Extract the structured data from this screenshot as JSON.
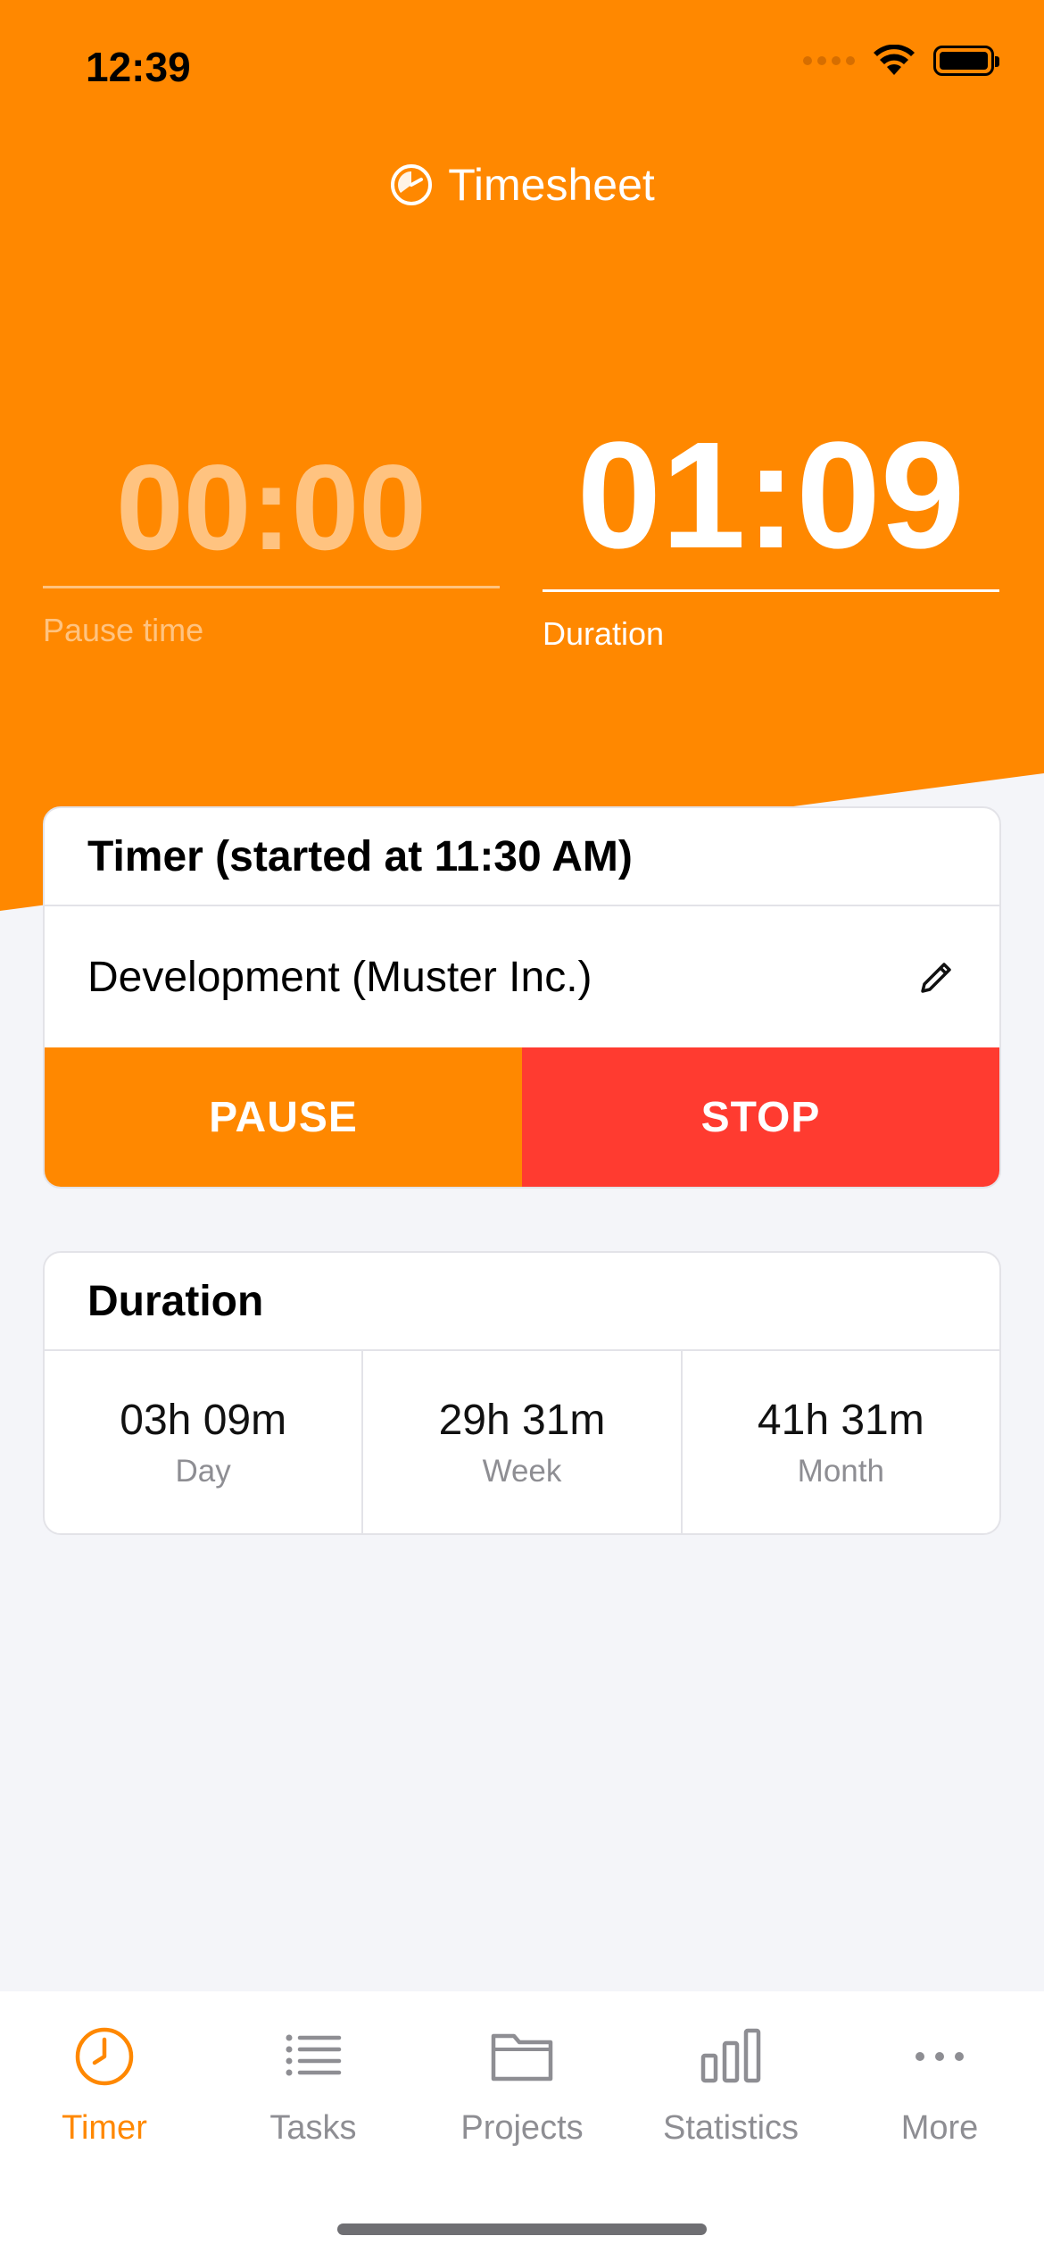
{
  "status_bar": {
    "time": "12:39"
  },
  "header": {
    "title": "Timesheet",
    "icon": "timer-logo-icon"
  },
  "timers": {
    "pause": {
      "value": "00:00",
      "label": "Pause time"
    },
    "duration": {
      "value": "01:09",
      "label": "Duration"
    }
  },
  "timer_card": {
    "title": "Timer (started at 11:30 AM)",
    "task": "Development (Muster Inc.)",
    "pause_label": "PAUSE",
    "stop_label": "STOP"
  },
  "duration_card": {
    "title": "Duration",
    "stats": [
      {
        "value": "03h 09m",
        "label": "Day"
      },
      {
        "value": "29h 31m",
        "label": "Week"
      },
      {
        "value": "41h 31m",
        "label": "Month"
      }
    ]
  },
  "tabbar": {
    "active": "Timer",
    "items": [
      {
        "label": "Timer",
        "icon": "clock-icon"
      },
      {
        "label": "Tasks",
        "icon": "list-icon"
      },
      {
        "label": "Projects",
        "icon": "folder-icon"
      },
      {
        "label": "Statistics",
        "icon": "bar-chart-icon"
      },
      {
        "label": "More",
        "icon": "more-icon"
      }
    ]
  },
  "colors": {
    "accent": "#FF8800",
    "stop": "#FF3B30",
    "background": "#F4F5F9"
  }
}
